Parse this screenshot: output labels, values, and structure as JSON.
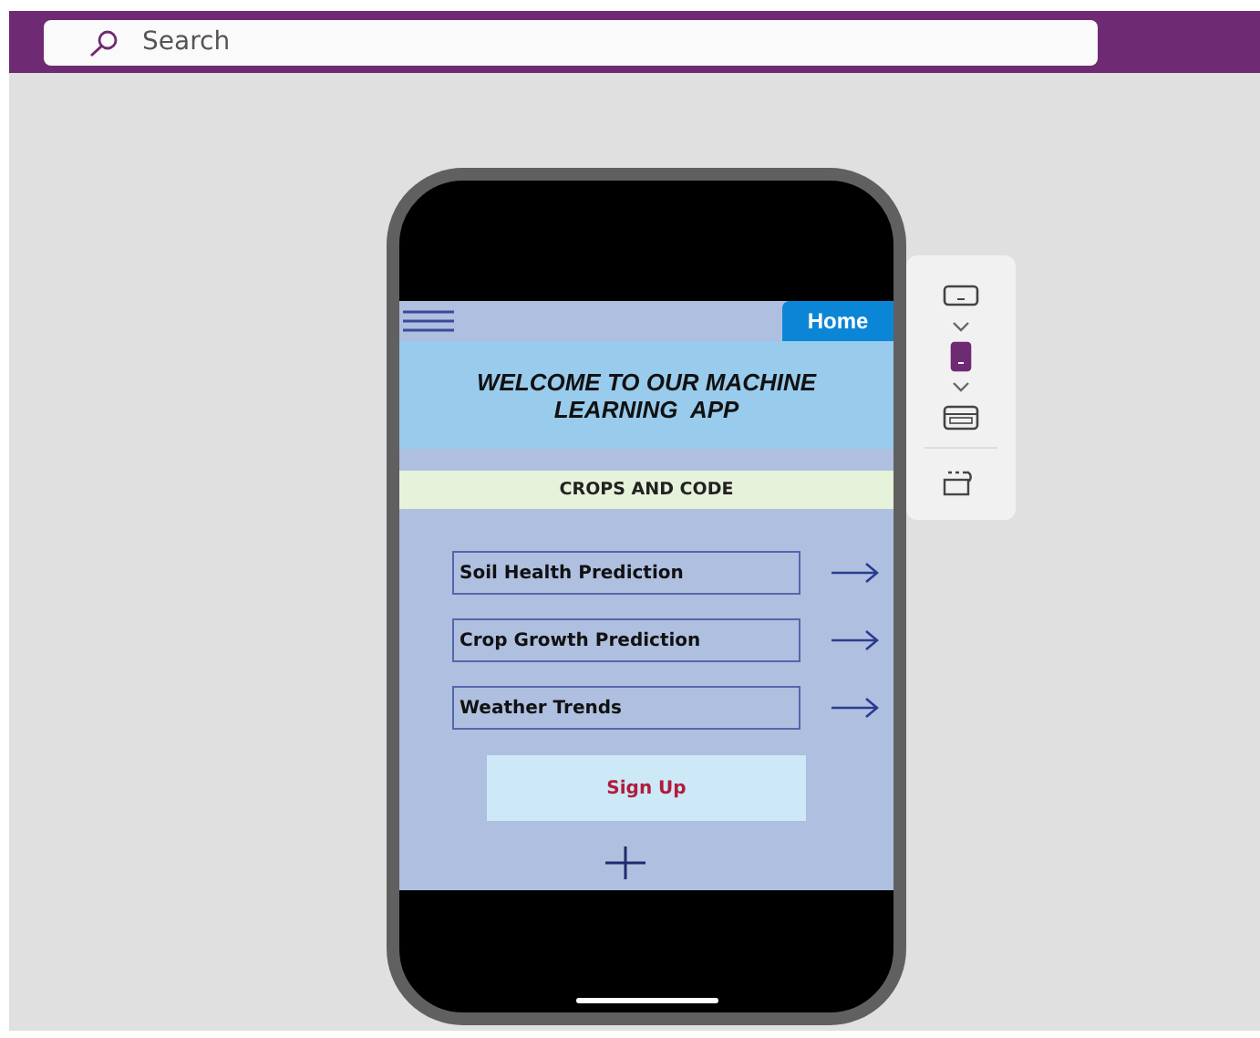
{
  "search": {
    "placeholder": "Search"
  },
  "app": {
    "home_button": "Home",
    "title": "WELCOME TO OUR MACHINE LEARNING  APP",
    "subtitle": "CROPS AND CODE",
    "items": [
      {
        "label": "Soil Health Prediction"
      },
      {
        "label": "Crop Growth Prediction"
      },
      {
        "label": "Weather Trends"
      }
    ],
    "signup_button": "Sign Up"
  },
  "side_panel": {
    "items": [
      {
        "kind": "landscape",
        "selected": false
      },
      {
        "kind": "portrait",
        "selected": true
      },
      {
        "kind": "web",
        "selected": false
      },
      {
        "kind": "rotate",
        "selected": false
      }
    ]
  }
}
